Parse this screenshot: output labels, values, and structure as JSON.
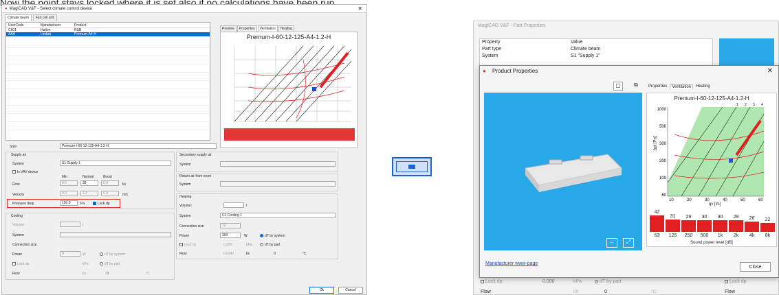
{
  "caption": "Now the point stays locked where it is set also if no calculations have been run.",
  "left_window": {
    "title": "MagiCAD V&F - Select climate control device",
    "tabs": [
      "Climate beam",
      "Fan coil unit"
    ],
    "columns": [
      "UserCode",
      "Manufacturer",
      "Product"
    ],
    "rows": [
      [
        "C601",
        "Halton",
        "RSB"
      ],
      [
        "AAA",
        "Lindab",
        "Premum-A4-H"
      ]
    ],
    "preview_tabs": [
      "Preview",
      "Properties",
      "Ventilation",
      "Heating"
    ],
    "chart_title": "Premum-I-60-12-125-A4-1.2-H",
    "size_label": "Size:",
    "size_value": "Premum-I-60-12-125-A4-1.2-H",
    "supply_air": "Supply air",
    "system_label": "System",
    "system_value": "S1 Supply 1",
    "vav": "Is VAV device",
    "min": "Min",
    "normal": "Normal",
    "boost": "Boost",
    "flow": "Flow",
    "flow_vals": [
      "0.0",
      "39",
      "0.0"
    ],
    "flow_unit": "l/s",
    "velocity": "Velocity",
    "vel_vals": [
      "0.0",
      "3.2",
      "0.0"
    ],
    "vel_unit": "m/s",
    "pressure_drop": "Pressure drop",
    "pd_value": "150.0",
    "pd_unit": "Pa",
    "lock_dp": "Lock dp",
    "cooling": "Cooling",
    "volume": "Volume:",
    "connection_size": "Connection size",
    "power": "Power",
    "power_val": "0",
    "w": "W",
    "dt_system": "dT by system",
    "kpa": "kPa",
    "dt_part": "dT by part",
    "flow_zero": "0",
    "deg": "°C",
    "secondary": "Secondary supply air",
    "return": "Return air from room",
    "heating": "Heating",
    "heat_system": "C1 Cooling 1",
    "conn_val": "12",
    "heat_power": "300",
    "kpa_val": "0.260",
    "lps_val": "0.0147",
    "lps": "l/s",
    "zero": "0",
    "ok": "Ok",
    "cancel": "Cancel",
    "l": "l"
  },
  "right_window": {
    "title": "MagiCAD V&F - Part Properties",
    "prop_header": [
      "Property",
      "Value"
    ],
    "props": [
      [
        "Part type",
        "Climate beam"
      ],
      [
        "System",
        "S1 \"Supply 1\""
      ]
    ],
    "dialog_title": "Product Properties",
    "tabs": [
      "Properties",
      "Ventilation",
      "Heating"
    ],
    "chart_title": "Premum-I-60-12-125-A4-1.2-H",
    "y_label": "Δpt [Pa]",
    "x_label": "qv [l/s]",
    "y_ticks": [
      "1000",
      "500",
      "300",
      "200",
      "100",
      "50"
    ],
    "x_ticks": [
      "10",
      "20",
      "30",
      "40",
      "50",
      "60"
    ],
    "top_ticks": [
      "1",
      "2",
      "3",
      "4"
    ],
    "sound_values": [
      "42",
      "31",
      "29",
      "30",
      "30",
      "29",
      "26",
      "22"
    ],
    "sound_freqs": [
      "63",
      "125",
      "250",
      "500",
      "1k",
      "2k",
      "4k",
      "8k"
    ],
    "sound_label": "Sound power level [dB]",
    "link": "Manufacturer www-page",
    "close": "Close",
    "bottom": {
      "lock_dp": "Lock dp",
      "kpa_val": "0.000",
      "kpa": "kPa",
      "dt_part": "dT by part",
      "flow": "Flow",
      "lps": "l/s",
      "zero": "0",
      "deg": "°C"
    }
  },
  "colors": {
    "accent": "#0a6ad1",
    "preview_bg": "#29a8e8",
    "bars": "#e02020",
    "grid_green": "#7bd67b"
  }
}
